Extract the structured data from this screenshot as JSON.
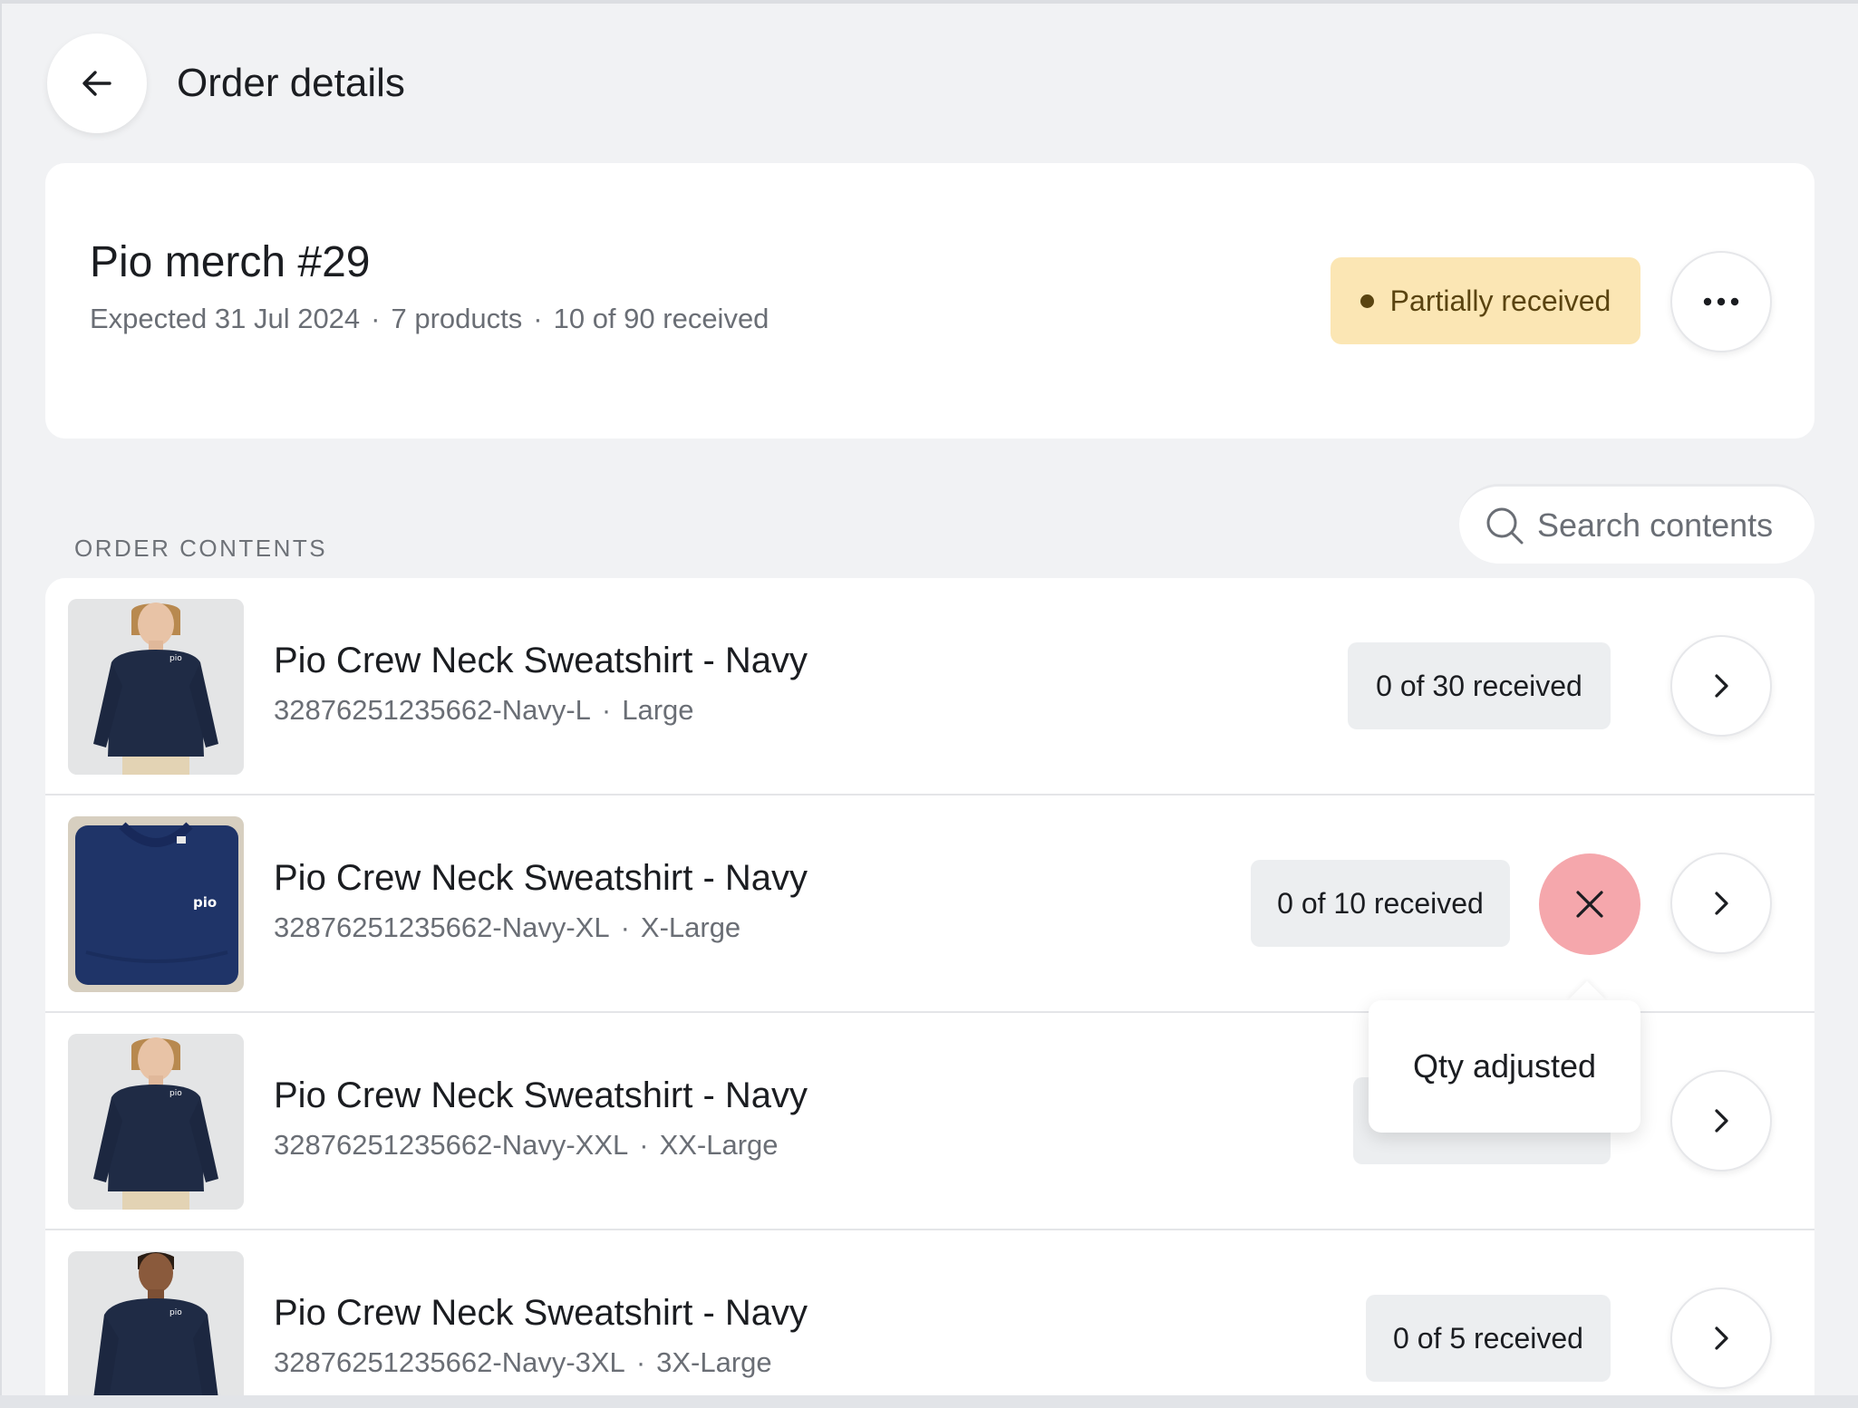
{
  "header": {
    "title": "Order details"
  },
  "order": {
    "name": "Pio merch #29",
    "expected": "Expected 31 Jul 2024",
    "products": "7 products",
    "received": "10 of 90 received",
    "status": "Partially received",
    "status_color": "#fbe6b4"
  },
  "section": {
    "label": "ORDER CONTENTS"
  },
  "search": {
    "placeholder": "Search contents"
  },
  "items": [
    {
      "name": "Pio Crew Neck Sweatshirt - Navy",
      "sku": "32876251235662-Navy-L",
      "size": "Large",
      "qty": "0 of 30 received"
    },
    {
      "name": "Pio Crew Neck Sweatshirt - Navy",
      "sku": "32876251235662-Navy-XL",
      "size": "X-Large",
      "qty": "0 of 10 received"
    },
    {
      "name": "Pio Crew Neck Sweatshirt - Navy",
      "sku": "32876251235662-Navy-XXL",
      "size": "XX-Large",
      "qty": ""
    },
    {
      "name": "Pio Crew Neck Sweatshirt - Navy",
      "sku": "32876251235662-Navy-3XL",
      "size": "3X-Large",
      "qty": "0 of 5 received"
    }
  ],
  "tooltip": {
    "text": "Qty adjusted"
  },
  "icons": {
    "back": "arrow-left-icon",
    "more": "more-horizontal-icon",
    "search": "search-icon",
    "chevron": "chevron-right-icon",
    "clear": "close-icon"
  },
  "colors": {
    "clear_button": "#f5a7ac",
    "background": "#f1f2f4"
  }
}
